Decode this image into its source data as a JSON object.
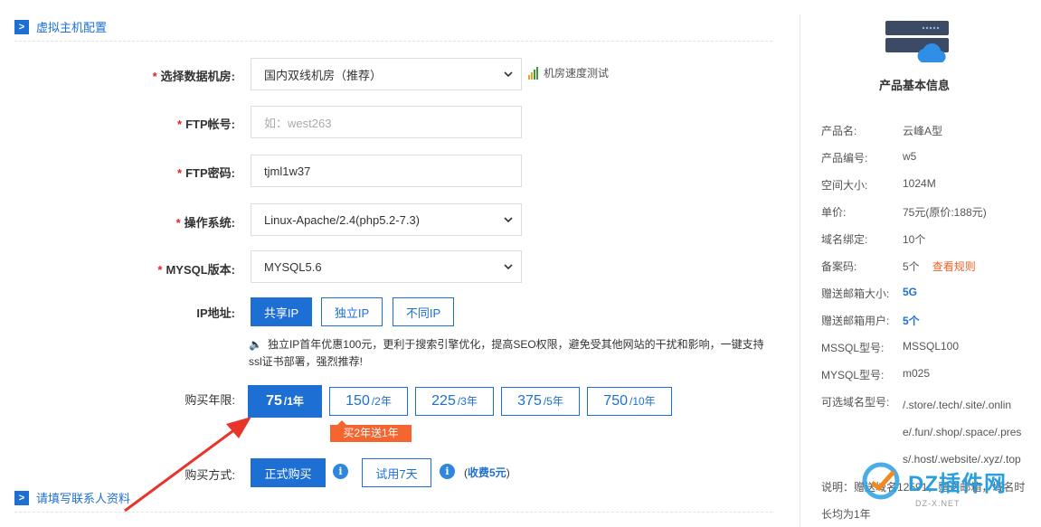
{
  "sections": {
    "host_config": "虚拟主机配置",
    "contact": "请填写联系人资料"
  },
  "form": {
    "datacenter_label": "选择数据机房:",
    "datacenter_value": "国内双线机房（推荐）",
    "speed_test": "机房速度测试",
    "ftp_account_label": "FTP帐号:",
    "ftp_account_placeholder": "如：west263",
    "ftp_password_label": "FTP密码:",
    "ftp_password_value": "tjml1w37",
    "os_label": "操作系统:",
    "os_value": "Linux-Apache/2.4(php5.2-7.3)",
    "mysql_label": "MYSQL版本:",
    "mysql_value": "MYSQL5.6",
    "ip_label": "IP地址:",
    "ip_options": [
      "共享IP",
      "独立IP",
      "不同IP"
    ],
    "ip_notice": "独立IP首年优惠100元，更利于搜索引擎优化，提高SEO权限，避免受其他网站的干扰和影响，一键支持ssl证书部署，强烈推荐!",
    "years_label": "购买年限:",
    "year_options": [
      {
        "price": "75",
        "unit": "/1年"
      },
      {
        "price": "150",
        "unit": "/2年"
      },
      {
        "price": "225",
        "unit": "/3年"
      },
      {
        "price": "375",
        "unit": "/5年"
      },
      {
        "price": "750",
        "unit": "/10年"
      }
    ],
    "promo": "买2年送1年",
    "buy_method_label": "购买方式:",
    "buy_formal": "正式购买",
    "buy_trial": "试用7天",
    "fee_prefix": "(",
    "fee_value": "收费5元",
    "fee_suffix": ")"
  },
  "sidebar": {
    "title": "产品基本信息",
    "rows": [
      {
        "k": "产品名:",
        "v": "云峰A型"
      },
      {
        "k": "产品编号:",
        "v": "w5"
      },
      {
        "k": "空间大小:",
        "v": "1024M"
      },
      {
        "k": "单价:",
        "v": "75元(原价:188元)"
      },
      {
        "k": "域名绑定:",
        "v": "10个"
      },
      {
        "k": "备案码:",
        "v": "5个",
        "extra": "查看规则"
      },
      {
        "k": "赠送邮箱大小:",
        "v": "5G"
      },
      {
        "k": "赠送邮箱用户:",
        "v": "5个"
      },
      {
        "k": "MSSQL型号:",
        "v": "MSSQL100"
      },
      {
        "k": "MYSQL型号:",
        "v": "m025"
      },
      {
        "k": "可选域名型号:",
        "v": ""
      }
    ],
    "domains": [
      "/.store/.tech/.site/.onlin",
      "e/.fun/.shop/.space/.pres",
      "s/.host/.website/.xyz/.top"
    ],
    "note_1": "说明：赠送域名12591，赠送邮箱，域名时",
    "note_2": "长均为1年"
  },
  "watermark": {
    "text": "DZ插件网",
    "sub": "DZ-X.NET"
  },
  "colors": {
    "primary": "#1e6fd3",
    "accent": "#f4652f",
    "required": "#e02424"
  }
}
